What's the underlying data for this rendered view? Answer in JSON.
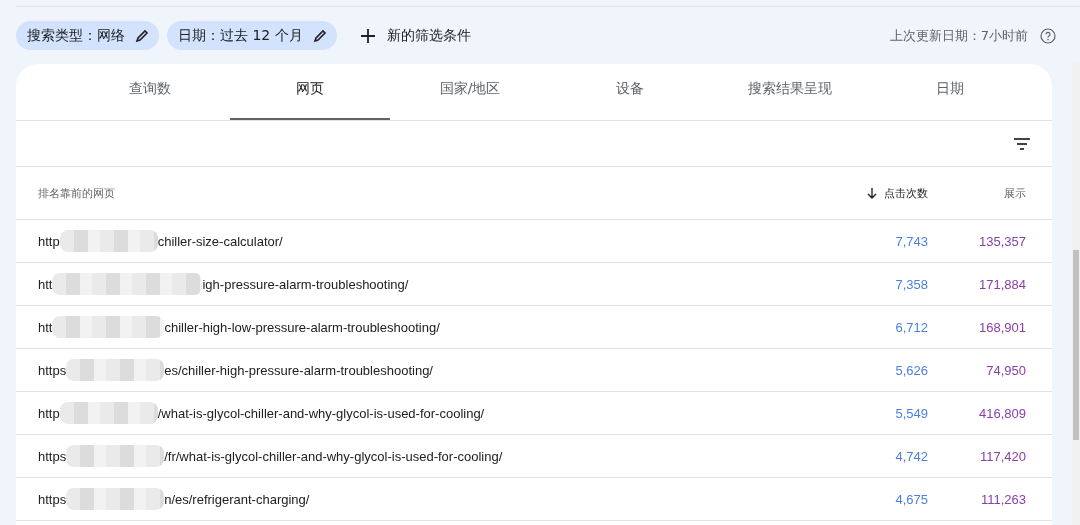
{
  "filters": [
    {
      "label": "搜索类型：网络"
    },
    {
      "label": "日期：过去 12 个月"
    }
  ],
  "add_filter": "新的筛选条件",
  "last_updated": "上次更新日期：7小时前",
  "tabs": [
    {
      "label": "查询数",
      "selected": false
    },
    {
      "label": "网页",
      "selected": true
    },
    {
      "label": "国家/地区",
      "selected": false
    },
    {
      "label": "设备",
      "selected": false
    },
    {
      "label": "搜索结果呈现",
      "selected": false
    },
    {
      "label": "日期",
      "selected": false
    }
  ],
  "table": {
    "columns": [
      {
        "label": "排名靠前的网页",
        "sorted": false
      },
      {
        "label": "点击次数",
        "sorted": true
      },
      {
        "label": "展示",
        "sorted": false
      }
    ],
    "rows": [
      {
        "url_start": "http",
        "url_end": "chiller-size-calculator/",
        "clicks": "7,743",
        "impressions": "135,357"
      },
      {
        "url_start": "htt",
        "url_end": "igh-pressure-alarm-troubleshooting/",
        "clicks": "7,358",
        "impressions": "171,884"
      },
      {
        "url_start": "htt",
        "url_end": "chiller-high-low-pressure-alarm-troubleshooting/",
        "clicks": "6,712",
        "impressions": "168,901"
      },
      {
        "url_start": "https",
        "url_end": "es/chiller-high-pressure-alarm-troubleshooting/",
        "clicks": "5,626",
        "impressions": "74,950"
      },
      {
        "url_start": "http",
        "url_end": "/what-is-glycol-chiller-and-why-glycol-is-used-for-cooling/",
        "clicks": "5,549",
        "impressions": "416,809"
      },
      {
        "url_start": "https",
        "url_end": "/fr/what-is-glycol-chiller-and-why-glycol-is-used-for-cooling/",
        "clicks": "4,742",
        "impressions": "117,420"
      },
      {
        "url_start": "https",
        "url_end": "n/es/refrigerant-charging/",
        "clicks": "4,675",
        "impressions": "111,263"
      }
    ]
  }
}
